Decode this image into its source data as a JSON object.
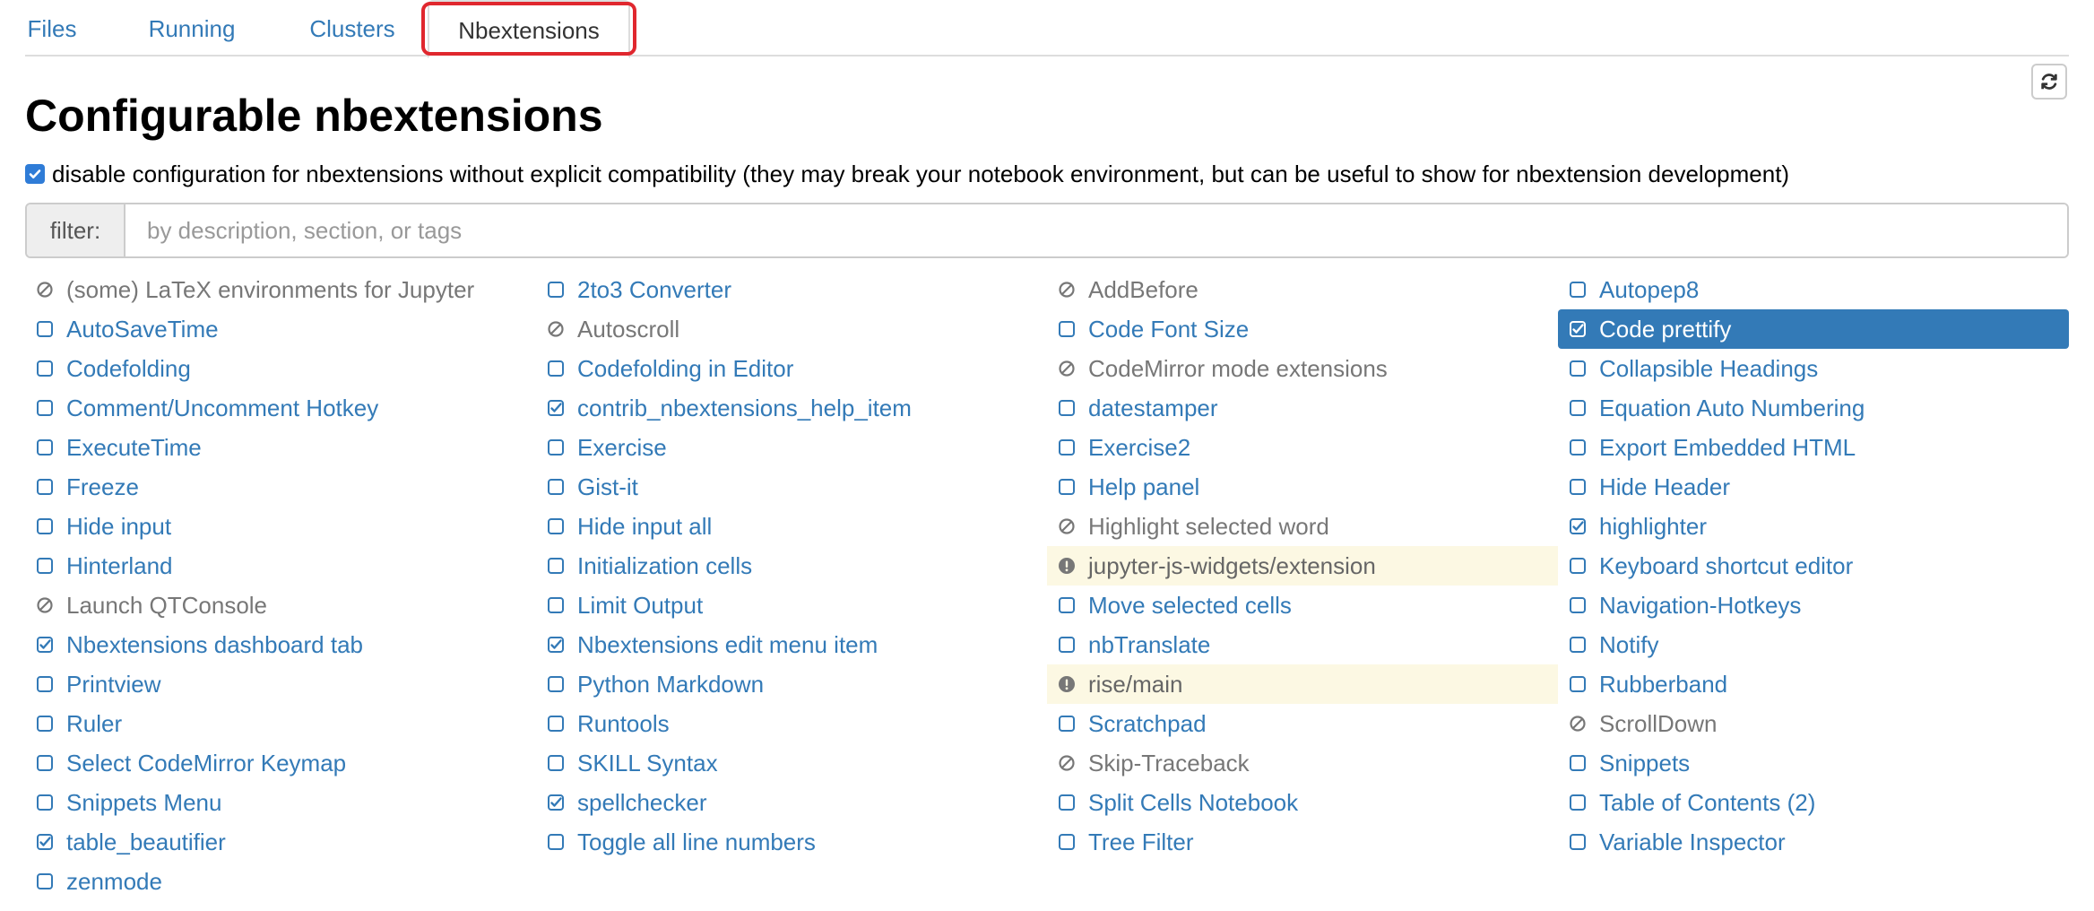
{
  "tabs": [
    {
      "label": "Files",
      "active": false
    },
    {
      "label": "Running",
      "active": false
    },
    {
      "label": "Clusters",
      "active": false
    },
    {
      "label": "Nbextensions",
      "active": true
    }
  ],
  "page_title": "Configurable nbextensions",
  "compat": {
    "checked": true,
    "label": "disable configuration for nbextensions without explicit compatibility (they may break your notebook environment, but can be useful to show for nbextension development)"
  },
  "filter": {
    "label": "filter:",
    "placeholder": "by description, section, or tags",
    "value": ""
  },
  "colors": {
    "link": "#337ab7",
    "selected_bg": "#337ab7",
    "warning_bg": "#fcf8e3",
    "highlight_box": "#e0272e"
  },
  "extensions": [
    {
      "label": "(some) LaTeX environments for Jupyter",
      "state": "disabled"
    },
    {
      "label": "2to3 Converter",
      "state": "unchecked"
    },
    {
      "label": "AddBefore",
      "state": "disabled"
    },
    {
      "label": "Autopep8",
      "state": "unchecked"
    },
    {
      "label": "AutoSaveTime",
      "state": "unchecked"
    },
    {
      "label": "Autoscroll",
      "state": "disabled"
    },
    {
      "label": "Code Font Size",
      "state": "unchecked"
    },
    {
      "label": "Code prettify",
      "state": "checked",
      "selected": true
    },
    {
      "label": "Codefolding",
      "state": "unchecked"
    },
    {
      "label": "Codefolding in Editor",
      "state": "unchecked"
    },
    {
      "label": "CodeMirror mode extensions",
      "state": "disabled"
    },
    {
      "label": "Collapsible Headings",
      "state": "unchecked"
    },
    {
      "label": "Comment/Uncomment Hotkey",
      "state": "unchecked"
    },
    {
      "label": "contrib_nbextensions_help_item",
      "state": "checked"
    },
    {
      "label": "datestamper",
      "state": "unchecked"
    },
    {
      "label": "Equation Auto Numbering",
      "state": "unchecked"
    },
    {
      "label": "ExecuteTime",
      "state": "unchecked"
    },
    {
      "label": "Exercise",
      "state": "unchecked"
    },
    {
      "label": "Exercise2",
      "state": "unchecked"
    },
    {
      "label": "Export Embedded HTML",
      "state": "unchecked"
    },
    {
      "label": "Freeze",
      "state": "unchecked"
    },
    {
      "label": "Gist-it",
      "state": "unchecked"
    },
    {
      "label": "Help panel",
      "state": "unchecked"
    },
    {
      "label": "Hide Header",
      "state": "unchecked"
    },
    {
      "label": "Hide input",
      "state": "unchecked"
    },
    {
      "label": "Hide input all",
      "state": "unchecked"
    },
    {
      "label": "Highlight selected word",
      "state": "disabled"
    },
    {
      "label": "highlighter",
      "state": "checked"
    },
    {
      "label": "Hinterland",
      "state": "unchecked"
    },
    {
      "label": "Initialization cells",
      "state": "unchecked"
    },
    {
      "label": "jupyter-js-widgets/extension",
      "state": "warning"
    },
    {
      "label": "Keyboard shortcut editor",
      "state": "unchecked"
    },
    {
      "label": "Launch QTConsole",
      "state": "disabled"
    },
    {
      "label": "Limit Output",
      "state": "unchecked"
    },
    {
      "label": "Move selected cells",
      "state": "unchecked"
    },
    {
      "label": "Navigation-Hotkeys",
      "state": "unchecked"
    },
    {
      "label": "Nbextensions dashboard tab",
      "state": "checked"
    },
    {
      "label": "Nbextensions edit menu item",
      "state": "checked"
    },
    {
      "label": "nbTranslate",
      "state": "unchecked"
    },
    {
      "label": "Notify",
      "state": "unchecked"
    },
    {
      "label": "Printview",
      "state": "unchecked"
    },
    {
      "label": "Python Markdown",
      "state": "unchecked"
    },
    {
      "label": "rise/main",
      "state": "warning"
    },
    {
      "label": "Rubberband",
      "state": "unchecked"
    },
    {
      "label": "Ruler",
      "state": "unchecked"
    },
    {
      "label": "Runtools",
      "state": "unchecked"
    },
    {
      "label": "Scratchpad",
      "state": "unchecked"
    },
    {
      "label": "ScrollDown",
      "state": "disabled"
    },
    {
      "label": "Select CodeMirror Keymap",
      "state": "unchecked"
    },
    {
      "label": "SKILL Syntax",
      "state": "unchecked"
    },
    {
      "label": "Skip-Traceback",
      "state": "disabled"
    },
    {
      "label": "Snippets",
      "state": "unchecked"
    },
    {
      "label": "Snippets Menu",
      "state": "unchecked"
    },
    {
      "label": "spellchecker",
      "state": "checked"
    },
    {
      "label": "Split Cells Notebook",
      "state": "unchecked"
    },
    {
      "label": "Table of Contents (2)",
      "state": "unchecked"
    },
    {
      "label": "table_beautifier",
      "state": "checked"
    },
    {
      "label": "Toggle all line numbers",
      "state": "unchecked"
    },
    {
      "label": "Tree Filter",
      "state": "unchecked"
    },
    {
      "label": "Variable Inspector",
      "state": "unchecked"
    },
    {
      "label": "zenmode",
      "state": "unchecked"
    }
  ]
}
